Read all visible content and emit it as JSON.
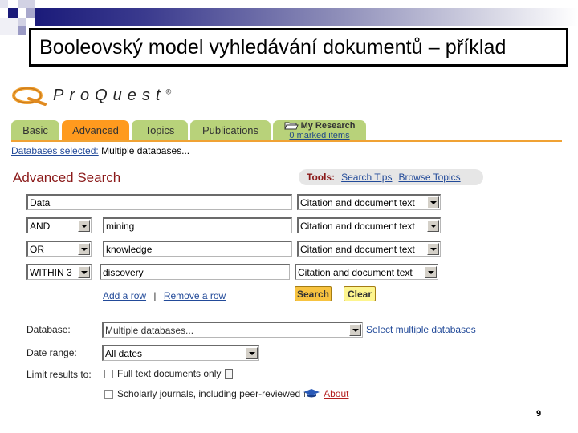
{
  "slide": {
    "title": "Booleovský model vyhledávání dokumentů – příklad",
    "page_number": "9"
  },
  "logo": {
    "text": "ProQuest",
    "mark": "®"
  },
  "tabs": [
    {
      "label": "Basic",
      "active": false
    },
    {
      "label": "Advanced",
      "active": true
    },
    {
      "label": "Topics",
      "active": false
    },
    {
      "label": "Publications",
      "active": false
    }
  ],
  "my_research": {
    "label": "My Research",
    "sub": "0 marked items"
  },
  "databases_selected": {
    "label": "Databases selected:",
    "value": "Multiple databases..."
  },
  "advanced_search": {
    "title": "Advanced Search"
  },
  "tools": {
    "label": "Tools:",
    "links": [
      "Search Tips",
      "Browse Topics"
    ]
  },
  "rows": [
    {
      "operator": null,
      "term": "Data",
      "field": "Citation and document text"
    },
    {
      "operator": "AND",
      "term": "mining",
      "field": "Citation and document text"
    },
    {
      "operator": "OR",
      "term": "knowledge",
      "field": "Citation and document text"
    },
    {
      "operator": "WITHIN 3",
      "term": "discovery",
      "field": "Citation and document text"
    }
  ],
  "row_links": {
    "add": "Add a row",
    "separator": "|",
    "remove": "Remove a row"
  },
  "buttons": {
    "search": "Search",
    "clear": "Clear"
  },
  "database": {
    "label": "Database:",
    "value": "Multiple databases...",
    "link": "Select multiple databases"
  },
  "date_range": {
    "label": "Date range:",
    "value": "All dates"
  },
  "limit": {
    "label": "Limit results to:",
    "options": [
      {
        "label": "Full text documents only",
        "checked": false
      },
      {
        "label": "Scholarly journals, including peer-reviewed",
        "checked": false
      }
    ],
    "about": "About"
  }
}
